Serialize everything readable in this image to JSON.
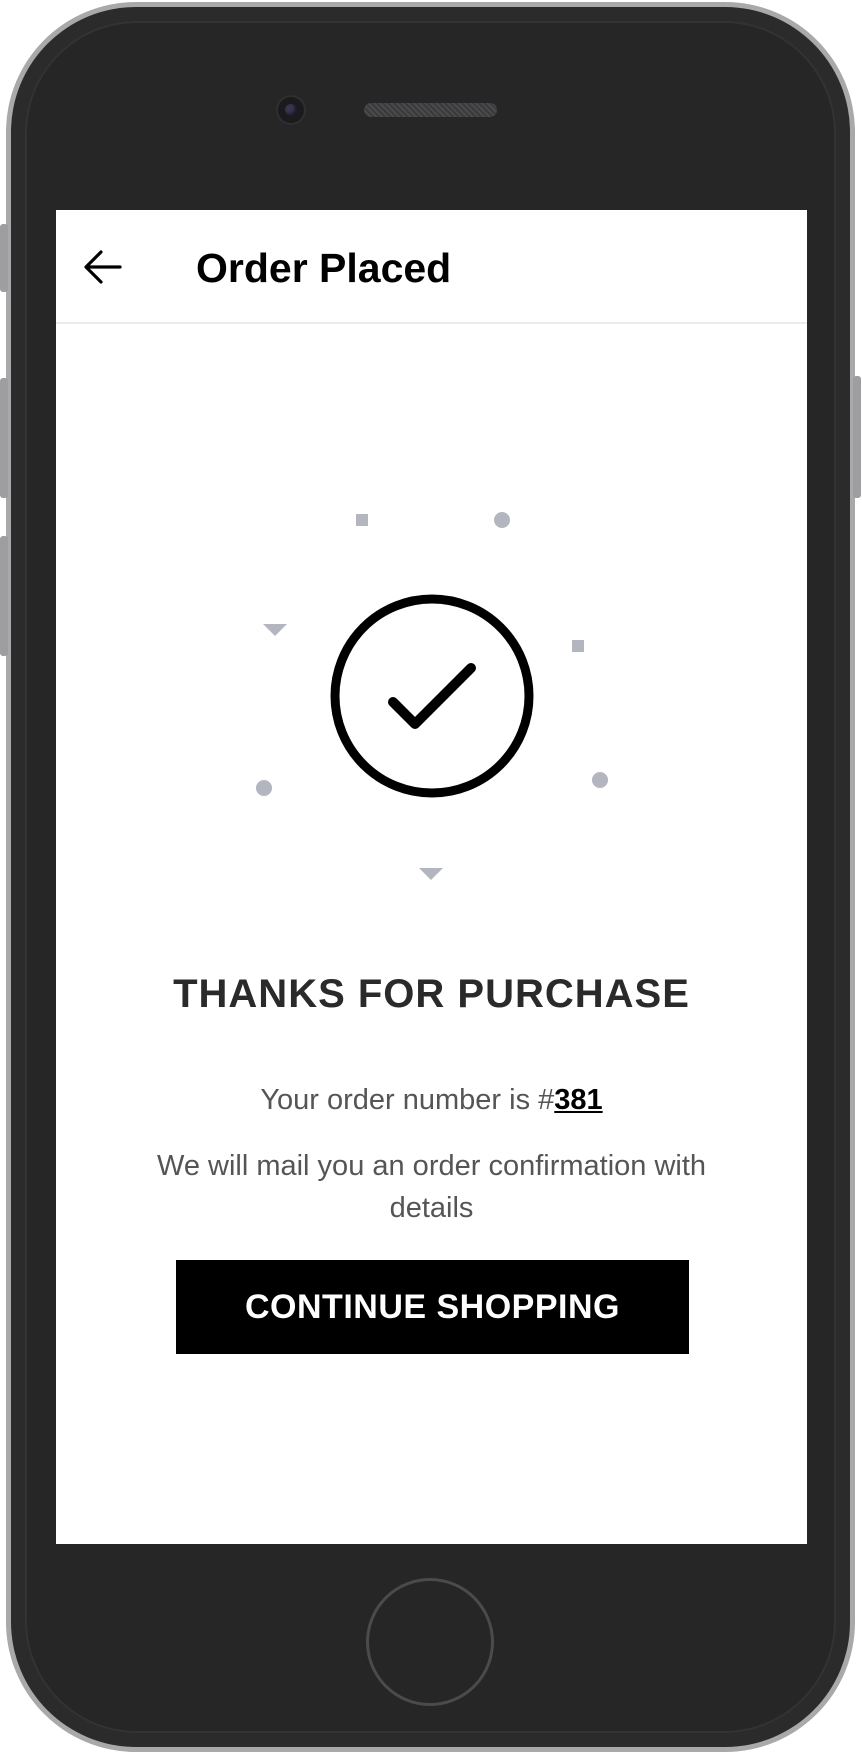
{
  "header": {
    "title": "Order Placed",
    "back_icon": "arrow-left-icon"
  },
  "confirmation": {
    "icon": "check-circle-icon",
    "heading": "THANKS FOR PURCHASE",
    "order_prefix": "Your order number is #",
    "order_number": "381",
    "mail_message": "We will mail you an order confirmation with details"
  },
  "actions": {
    "continue_label": "CONTINUE SHOPPING"
  },
  "colors": {
    "accent": "#000000",
    "confetti": "#b3b6bf",
    "text_muted": "#555555"
  }
}
